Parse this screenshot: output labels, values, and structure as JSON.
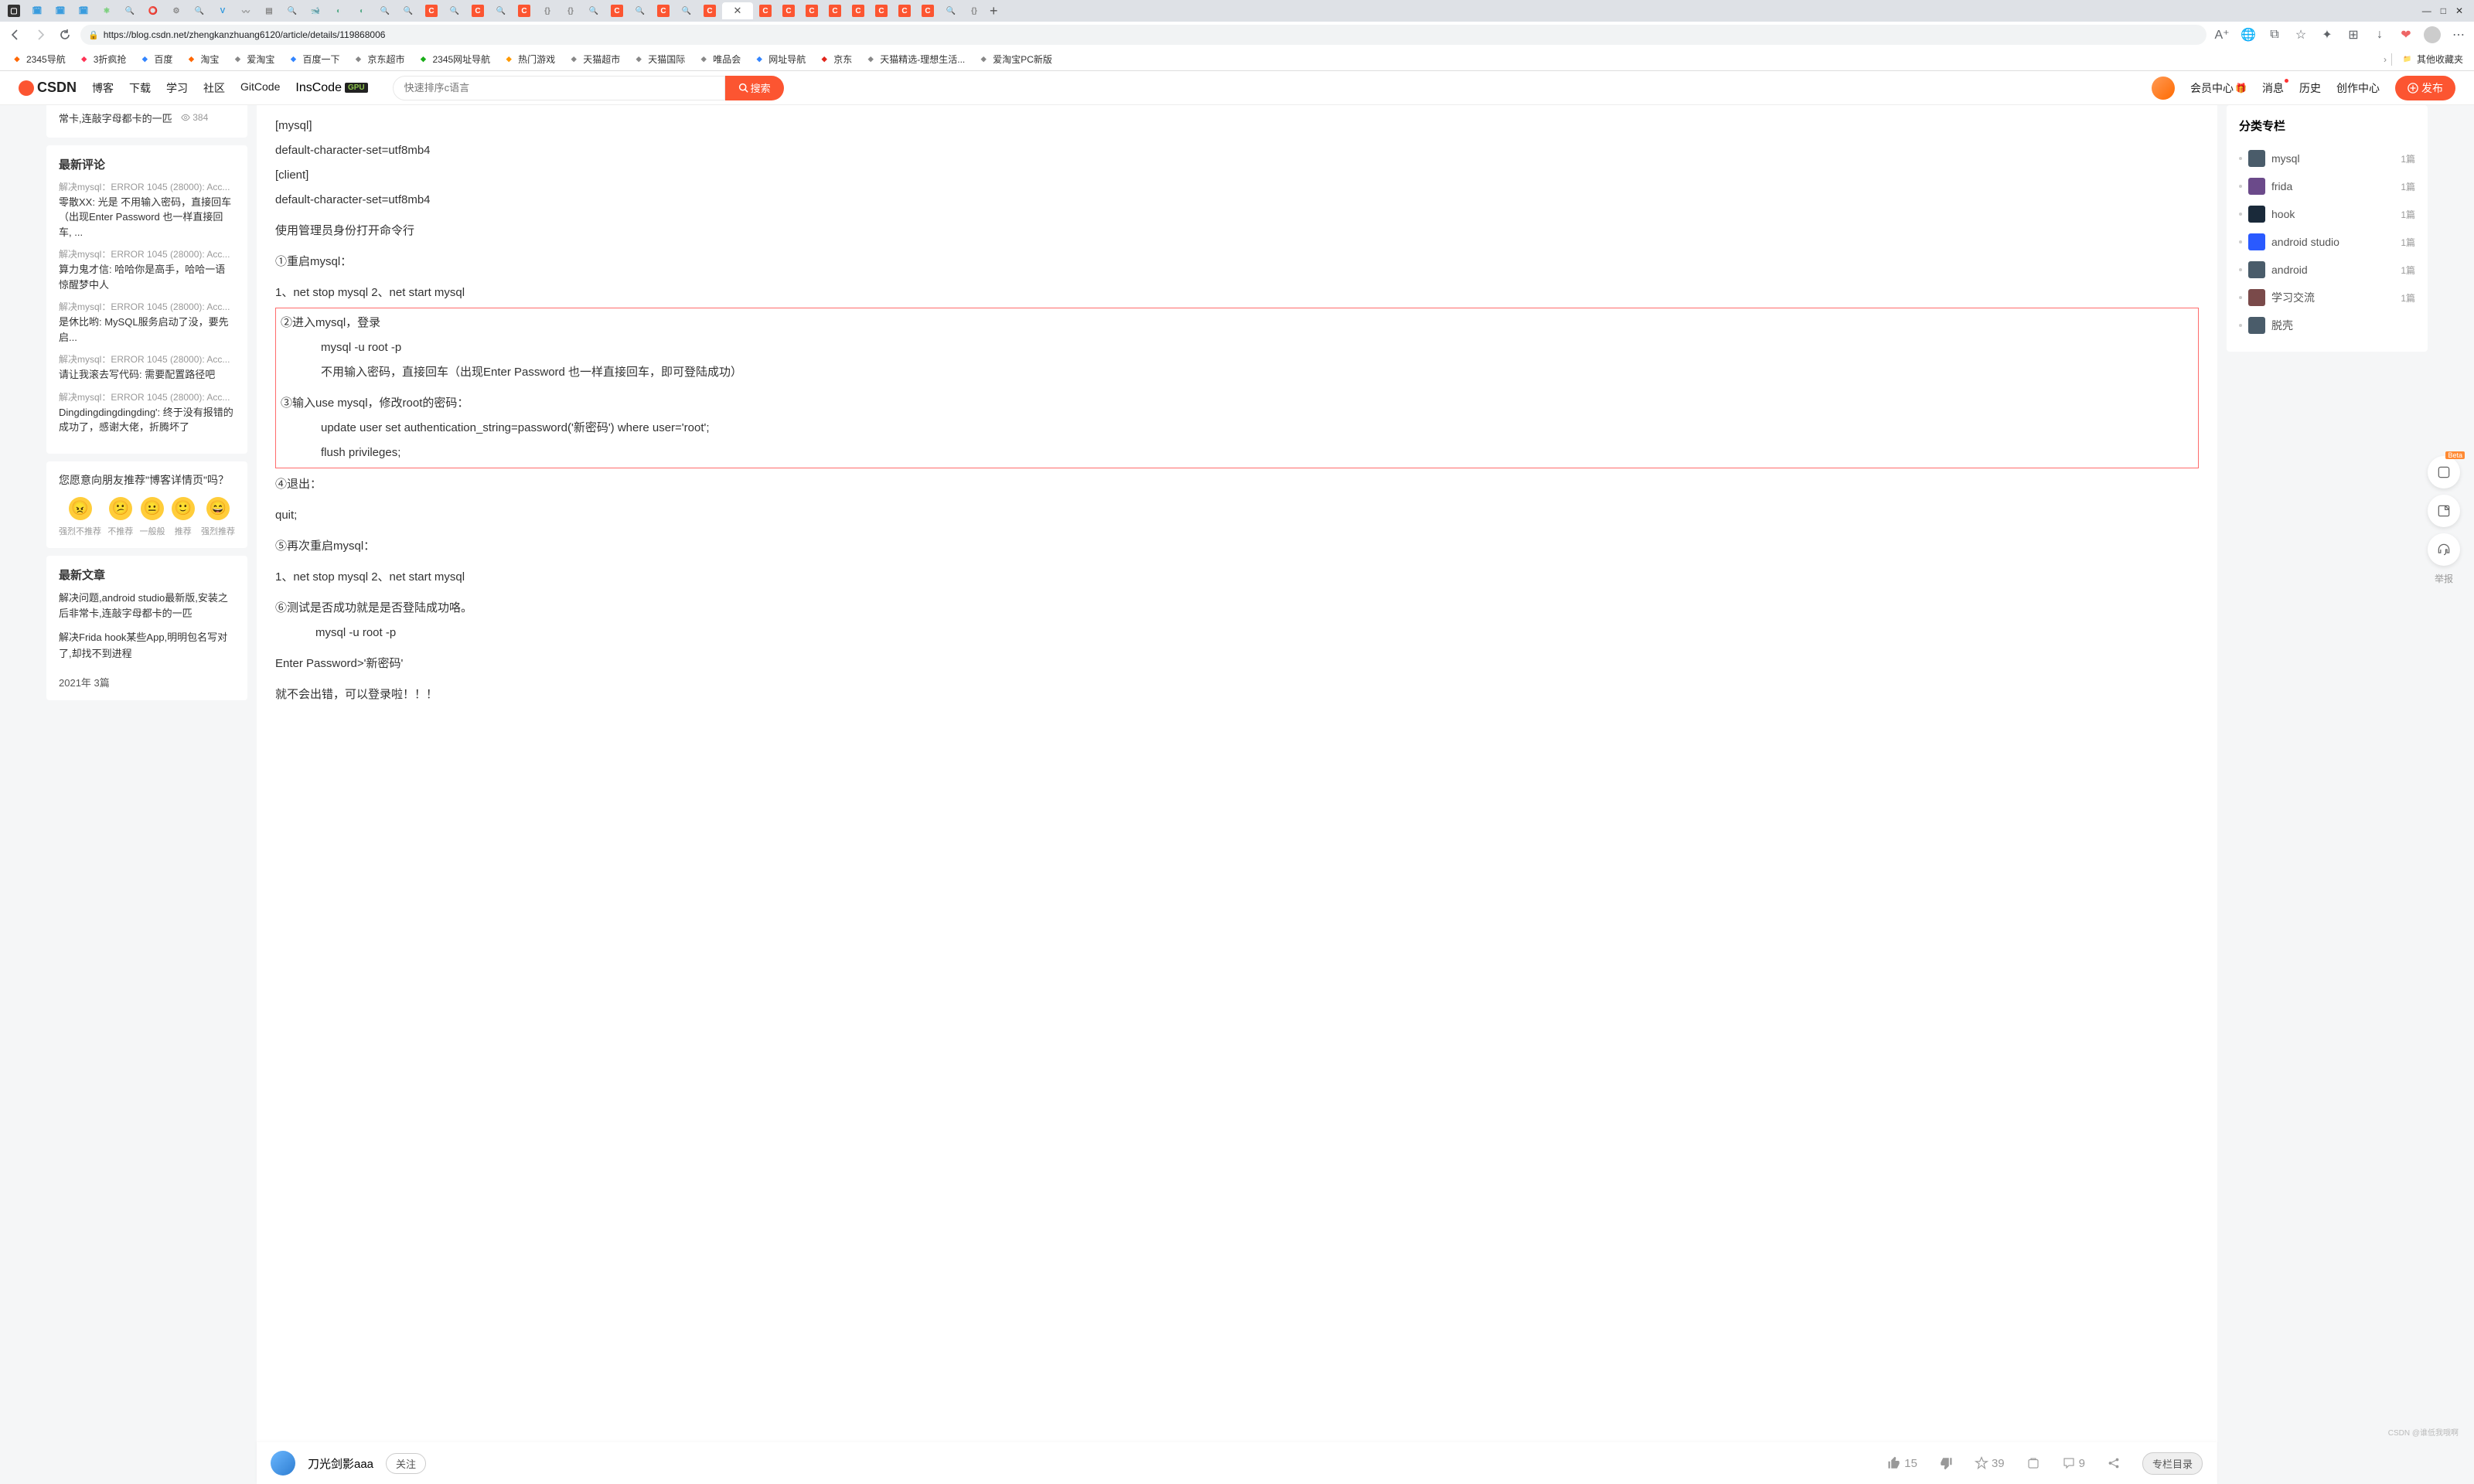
{
  "browser": {
    "url": "https://blog.csdn.net/zhengkanzhuang6120/article/details/119868006",
    "new_tab": "+",
    "win_min": "—",
    "win_max": "□",
    "win_close": "✕",
    "tab_close": "✕"
  },
  "bookmarks": [
    {
      "label": "2345导航",
      "color": "#ff6600"
    },
    {
      "label": "3折疯抢",
      "color": "#ff3355"
    },
    {
      "label": "百度",
      "color": "#3385ff"
    },
    {
      "label": "淘宝",
      "color": "#ff6600"
    },
    {
      "label": "爱淘宝",
      "color": "#888"
    },
    {
      "label": "百度一下",
      "color": "#3385ff"
    },
    {
      "label": "京东超市",
      "color": "#888"
    },
    {
      "label": "2345网址导航",
      "color": "#1aad19"
    },
    {
      "label": "热门游戏",
      "color": "#ff9900"
    },
    {
      "label": "天猫超市",
      "color": "#888"
    },
    {
      "label": "天猫国际",
      "color": "#888"
    },
    {
      "label": "唯品会",
      "color": "#888"
    },
    {
      "label": "网址导航",
      "color": "#3385ff"
    },
    {
      "label": "京东",
      "color": "#e1251b"
    },
    {
      "label": "天猫精选-理想生活...",
      "color": "#888"
    },
    {
      "label": "爱淘宝PC新版",
      "color": "#888"
    }
  ],
  "bm_right": "其他收藏夹",
  "csdn": {
    "logo": "CSDN",
    "nav": [
      "博客",
      "下载",
      "学习",
      "社区",
      "GitCode"
    ],
    "inscode": "InsCode",
    "gpu": "GPU",
    "search_placeholder": "快速排序c语言",
    "search_btn": "搜索",
    "right": {
      "vip": "会员中心",
      "msg": "消息",
      "history": "历史",
      "create": "创作中心",
      "publish": "发布"
    }
  },
  "left": {
    "prev_article": "常卡,连敲字母都卡的一匹",
    "prev_views": "384",
    "comments_title": "最新评论",
    "comments": [
      {
        "title": "解决mysql：ERROR 1045 (28000): Acc...",
        "body": "零散XX: 光是 不用输入密码，直接回车（出现Enter Password 也一样直接回车, ..."
      },
      {
        "title": "解决mysql：ERROR 1045 (28000): Acc...",
        "body": "算力鬼才信: 哈哈你是高手，哈哈一语惊醒梦中人"
      },
      {
        "title": "解决mysql：ERROR 1045 (28000): Acc...",
        "body": "是休比哟: MySQL服务启动了没，要先启..."
      },
      {
        "title": "解决mysql：ERROR 1045 (28000): Acc...",
        "body": "请让我滚去写代码: 需要配置路径吧"
      },
      {
        "title": "解决mysql：ERROR 1045 (28000): Acc...",
        "body": "Dingdingdingdingding': 终于没有报错的成功了，感谢大佬，折腾坏了"
      }
    ],
    "recommend_q": "您愿意向朋友推荐\"博客详情页\"吗？",
    "emojis": [
      {
        "face": "😠",
        "label": "强烈不推荐",
        "bg": "#ffcd3a"
      },
      {
        "face": "😕",
        "label": "不推荐",
        "bg": "#ffcd3a"
      },
      {
        "face": "😐",
        "label": "一般般",
        "bg": "#ffcd3a"
      },
      {
        "face": "🙂",
        "label": "推荐",
        "bg": "#ffcd3a"
      },
      {
        "face": "😄",
        "label": "强烈推荐",
        "bg": "#ffcd3a"
      }
    ],
    "articles_title": "最新文章",
    "articles": [
      "解决问题,android studio最新版,安装之后非常卡,连敲字母都卡的一匹",
      "解决Frida hook某些App,明明包名写对了,却找不到进程"
    ],
    "year": "2021年  3篇"
  },
  "article": {
    "l1": "[mysql]",
    "l2": "default-character-set=utf8mb4",
    "l3": "[client]",
    "l4": "default-character-set=utf8mb4",
    "l5": "使用管理员身份打开命令行",
    "l6": "①重启mysql：",
    "l7": "1、net stop mysql 2、net start mysql",
    "l8": "②进入mysql，登录",
    "l9": "mysql -u root -p",
    "l10": "不用输入密码，直接回车（出现Enter Password 也一样直接回车，即可登陆成功）",
    "l11": "③输入use mysql，修改root的密码：",
    "l12": "update user set authentication_string=password('新密码') where user='root';",
    "l13": "flush privileges;",
    "l14": "④退出：",
    "l15": "quit;",
    "l16": "⑤再次重启mysql：",
    "l17": "1、net stop mysql 2、net start mysql",
    "l18": "⑥测试是否成功就是是否登陆成功咯。",
    "l19": "mysql -u root -p",
    "l20": "Enter Password>'新密码'",
    "l21": "就不会出错，可以登录啦！！！"
  },
  "right": {
    "title": "分类专栏",
    "cats": [
      {
        "name": "mysql",
        "count": "1篇",
        "bg": "#4a5c6a"
      },
      {
        "name": "frida",
        "count": "1篇",
        "bg": "#6b4a8a"
      },
      {
        "name": "hook",
        "count": "1篇",
        "bg": "#1a2a3a"
      },
      {
        "name": "android studio",
        "count": "1篇",
        "bg": "#2a5aff"
      },
      {
        "name": "android",
        "count": "1篇",
        "bg": "#4a5c6a"
      },
      {
        "name": "学习交流",
        "count": "1篇",
        "bg": "#7a4a4a"
      },
      {
        "name": "脱壳",
        "count": "",
        "bg": "#4a5c6a"
      }
    ]
  },
  "bottom": {
    "author": "刀光剑影aaa",
    "follow": "关注",
    "like": "15",
    "star": "39",
    "comment": "9",
    "toc": "专栏目录"
  },
  "float": {
    "beta": "Beta",
    "report": "举报"
  },
  "watermark": "CSDN @谁低我哦啊"
}
